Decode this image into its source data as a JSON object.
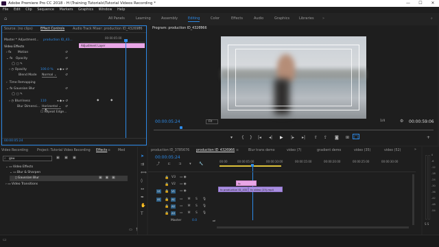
{
  "window": {
    "title": "Adobe Premiere Pro CC 2018 - H:\\Training Tutorials\\Tutorial Videos Recording *",
    "min": "—",
    "max": "☐",
    "close": "✕"
  },
  "menu": [
    "File",
    "Edit",
    "Clip",
    "Sequence",
    "Markers",
    "Graphics",
    "Window",
    "Help"
  ],
  "workspaces": [
    "All Panels",
    "Learning",
    "Assembly",
    "Editing",
    "Color",
    "Effects",
    "Audio",
    "Graphics",
    "Libraries"
  ],
  "workspace_active": "Editing",
  "source_panel": {
    "tabs": [
      "Source: (no clips)",
      "Effect Controls",
      "Audio Track Mixer: production ID_4326966"
    ],
    "master": "Master * Adjustment...",
    "seq": "production ID_43...",
    "timecode": "00:00:05:00",
    "clip_label": "Adjustment Layer",
    "section": "Video Effects",
    "effects": {
      "motion": "Motion",
      "opacity": "Opacity",
      "opacity_param": "Opacity",
      "opacity_val": "100.0 %",
      "blend": "Blend Mode",
      "blend_val": "Normal",
      "time_remap": "Time Remapping",
      "gaussian": "Gaussian Blur",
      "blurriness": "Blurriness",
      "blurriness_val": "110",
      "blur_dim": "Blur Dimensi...",
      "blur_dim_val": "Horizontal",
      "repeat_edge": "Repeat Edge..."
    },
    "bottom_tc": "00:00:05:24"
  },
  "program": {
    "tab": "Program: production ID_4326966",
    "timecode": "00:00:05:24",
    "fit": "Fit",
    "ratio": "1/4",
    "duration": "00:00:59:06"
  },
  "effects_panel": {
    "tabs": [
      "Video Recording",
      "Project: Tutorial Video Recording",
      "Effects",
      "Med"
    ],
    "search": "gau",
    "tree": [
      "Video Effects",
      "Blur & Sharpen",
      "Gaussian Blur",
      "Video Transitions"
    ]
  },
  "timeline": {
    "tabs": [
      "production ID_3785676",
      "production ID_4326966",
      "Blur trans demo",
      "video (7)",
      "gradient demo",
      "video (35)",
      "video (52)"
    ],
    "timecode": "00:00:05:24",
    "ruler": [
      "00:00",
      "00:00:05:00",
      "00:00:10:00",
      "00:00:15:00",
      "00:00:20:00",
      "00:00:25:00",
      "00:00:30:00"
    ],
    "tracks": {
      "v3": "V3",
      "v2": "V2",
      "v1": "V1",
      "a1": "A1",
      "a2": "A2",
      "a3": "A3",
      "master": "Master",
      "master_val": "0.0",
      "src_v": "V1",
      "src_a": "A1"
    },
    "clips": {
      "adjustment": "Adjustment",
      "clip1": "production ID_432",
      "clip2": "video (23).mp4"
    }
  },
  "meter": [
    "0",
    "-6",
    "-12",
    "-18",
    "-24",
    "-30",
    "-36",
    "-42",
    "-48",
    "-54"
  ],
  "colors": {
    "accent": "#2d8ceb",
    "adjustment_clip": "#e9a6e6",
    "video_clip": "#a98ee0"
  }
}
